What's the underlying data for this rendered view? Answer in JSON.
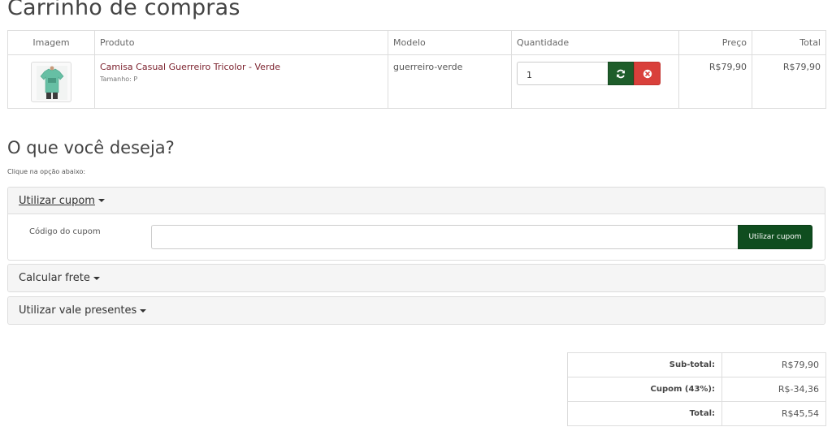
{
  "page": {
    "title": "Carrinho de compras"
  },
  "cart_table": {
    "headers": {
      "image": "Imagem",
      "product": "Produto",
      "model": "Modelo",
      "quantity": "Quantidade",
      "price": "Preço",
      "total": "Total"
    },
    "rows": [
      {
        "product_name": "Camisa Casual Guerreiro Tricolor - Verde",
        "option": "Tamanho: P",
        "model": "guerreiro-verde",
        "quantity": "1",
        "price": "R$79,90",
        "total": "R$79,90",
        "thumb_icon": "green-shirt-thumbnail"
      }
    ],
    "icons": {
      "refresh": "refresh-icon",
      "remove": "times-circle-icon"
    },
    "colors": {
      "refresh_button": "#1e5d2a",
      "remove_button": "#d9403b",
      "product_link": "#7a1f2b"
    }
  },
  "options": {
    "title": "O que você deseja?",
    "subtitle": "Clique na opção abaixo:",
    "coupon": {
      "heading": "Utilizar cupom",
      "label": "Código do cupom",
      "input_value": "",
      "button_label": "Utilizar cupom"
    },
    "shipping": {
      "heading": "Calcular frete"
    },
    "voucher": {
      "heading": "Utilizar vale presentes"
    },
    "colors": {
      "coupon_button": "#0f4d1f",
      "panel_heading_bg": "#f5f5f5"
    }
  },
  "totals": [
    {
      "label": "Sub-total:",
      "value": "R$79,90"
    },
    {
      "label": "Cupom (43%):",
      "value": "R$-34,36"
    },
    {
      "label": "Total:",
      "value": "R$45,54"
    }
  ]
}
